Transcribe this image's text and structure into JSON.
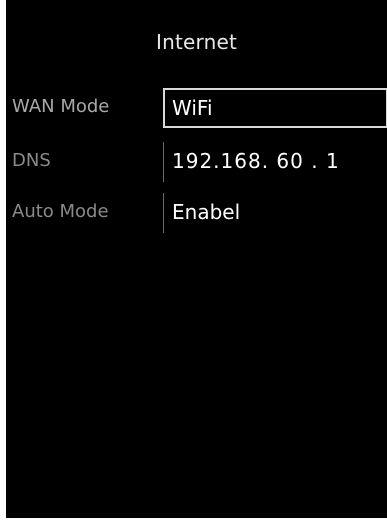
{
  "header": {
    "title": "Internet"
  },
  "settings": {
    "wan_mode": {
      "label": "WAN Mode",
      "value": "WiFi"
    },
    "dns": {
      "label": "DNS",
      "value": "192.168. 60 .  1"
    },
    "auto_mode": {
      "label": "Auto Mode",
      "value": "Enabel"
    }
  },
  "colors": {
    "background": "#000000",
    "label_text": "#8a8a8a",
    "value_text": "#ffffff",
    "selection_border": "#d9d9d9"
  }
}
